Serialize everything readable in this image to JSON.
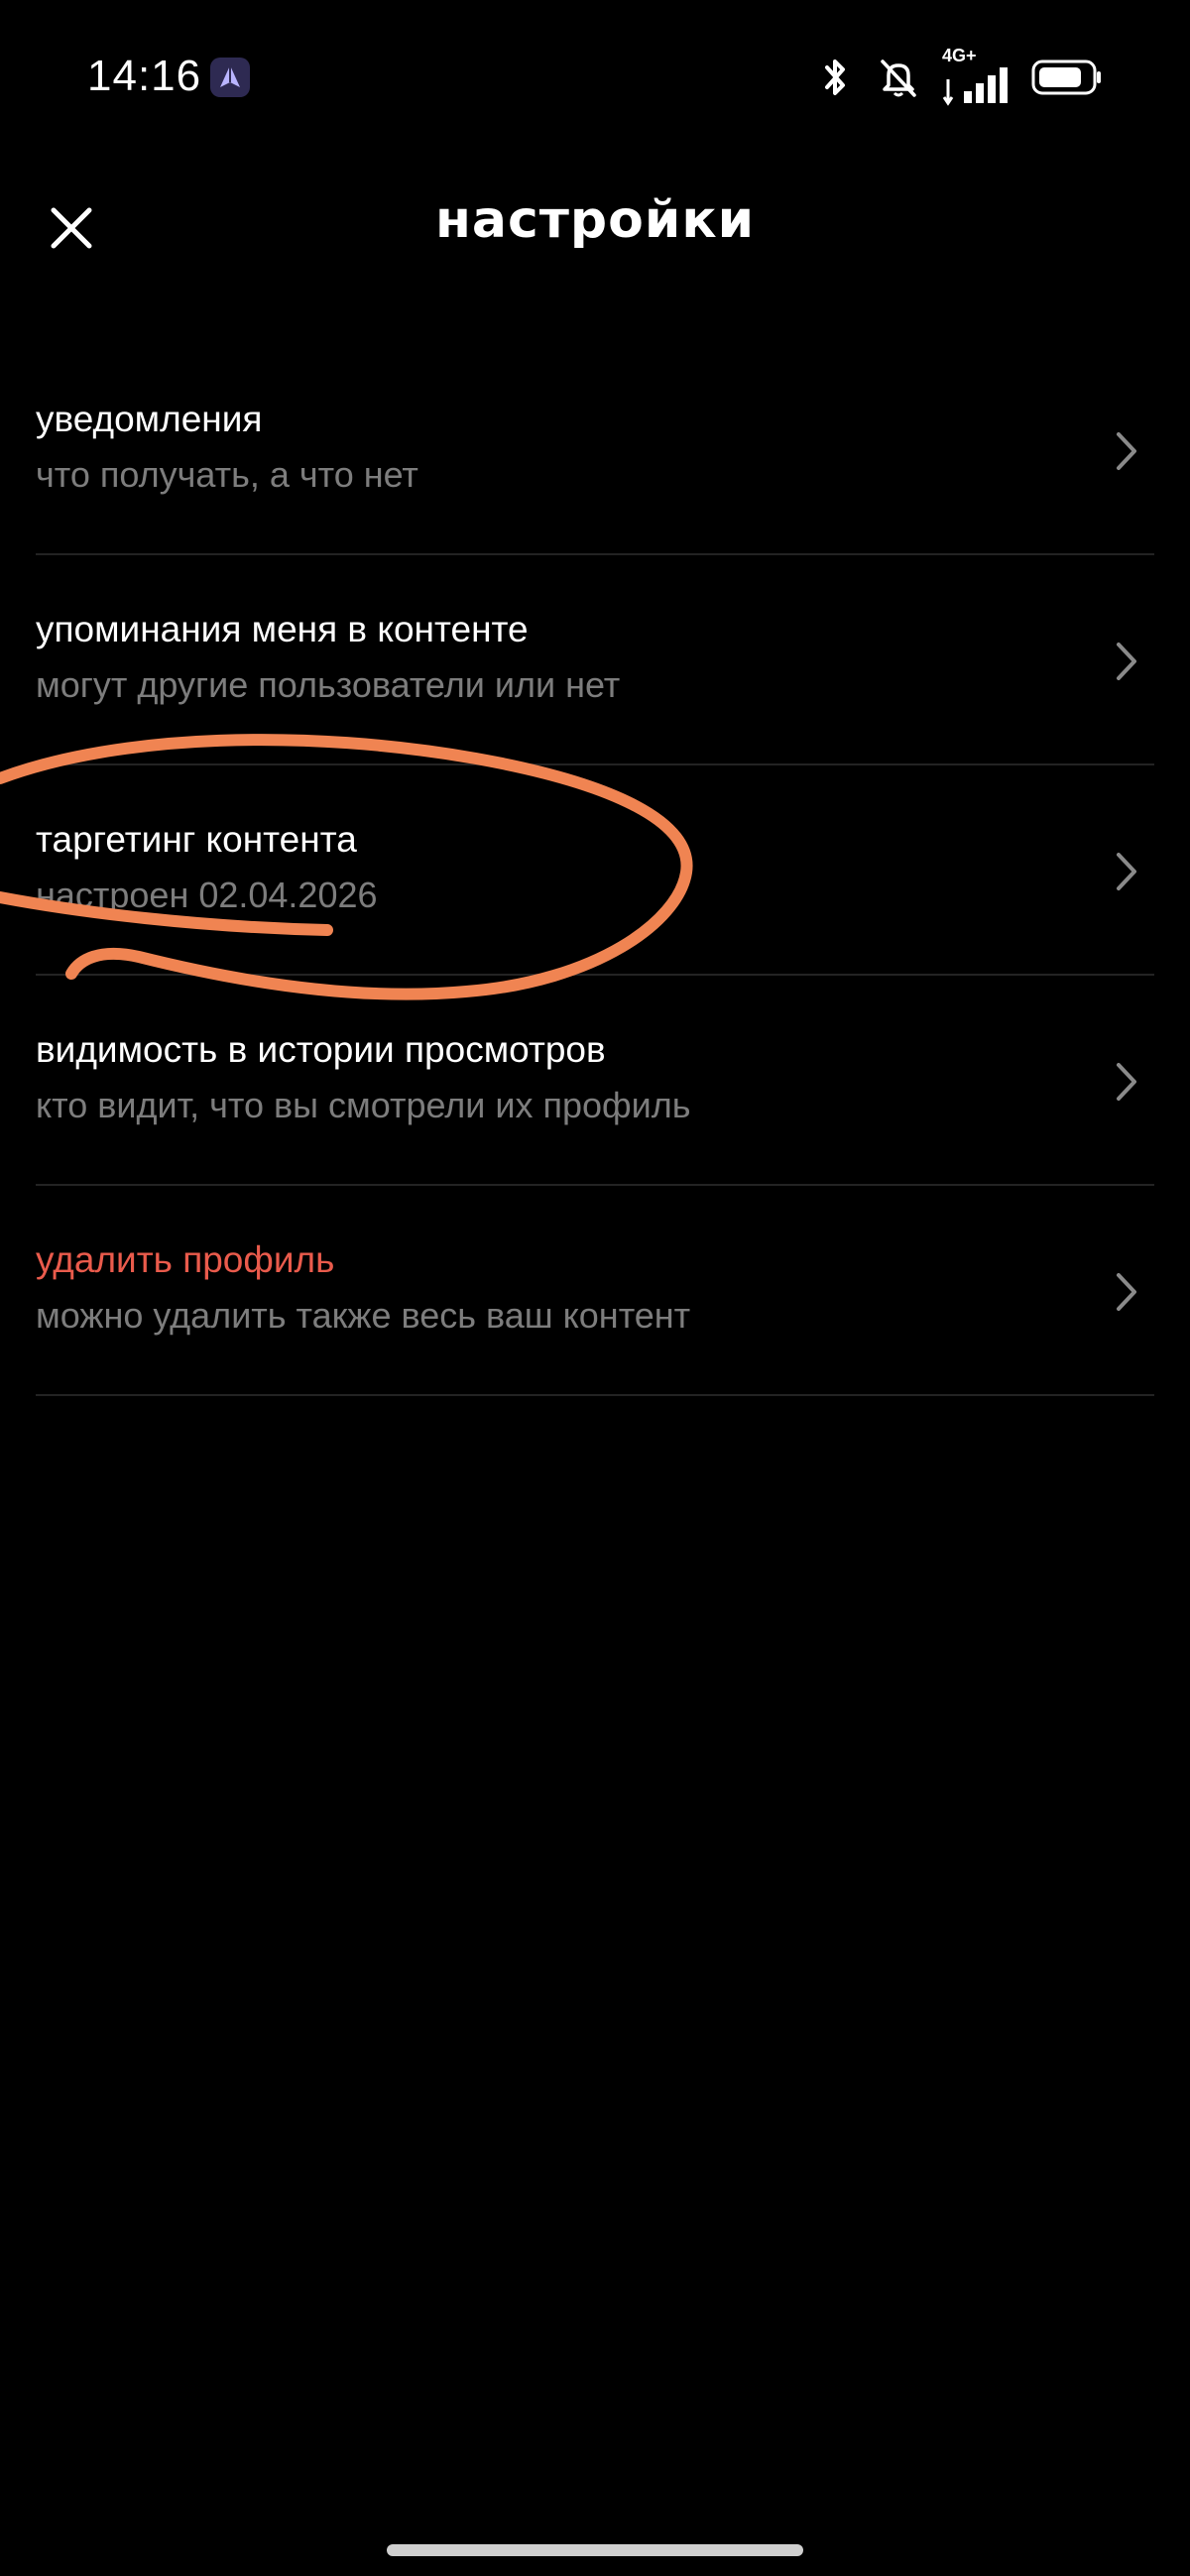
{
  "status_bar": {
    "time": "14:16",
    "network": "4G+",
    "icons": [
      "bluetooth-icon",
      "bell-muted-icon",
      "signal-icon",
      "battery-icon"
    ]
  },
  "header": {
    "title": "настройки",
    "close_icon": "close-icon"
  },
  "settings": {
    "items": [
      {
        "title": "уведомления",
        "subtitle": "что получать, а что нет"
      },
      {
        "title": "упоминания меня в контенте",
        "subtitle": "могут другие пользователи или нет"
      },
      {
        "title": "таргетинг контента",
        "subtitle": "настроен 02.04.2026"
      },
      {
        "title": "видимость в истории просмотров",
        "subtitle": "кто видит, что вы смотрели их профиль"
      },
      {
        "title": "удалить профиль",
        "subtitle": "можно удалить также весь ваш контент"
      }
    ]
  },
  "colors": {
    "background": "#000000",
    "text_primary": "#ffffff",
    "text_secondary": "#7d7d7d",
    "danger": "#ea5b4c",
    "annotation": "#f08452",
    "divider": "#232323"
  }
}
